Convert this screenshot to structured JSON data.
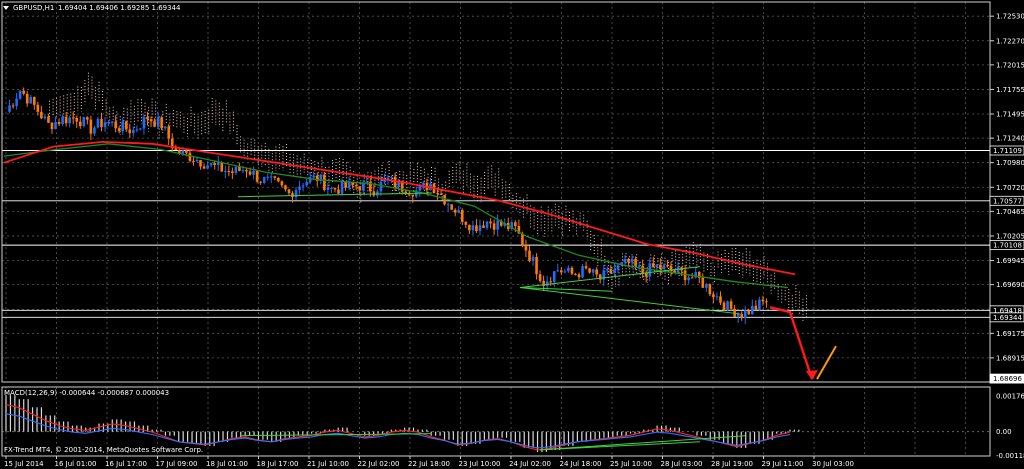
{
  "header": {
    "symbol": "GBPUSD,H1",
    "ohlc": "1.69404 1.69406 1.69285 1.69344"
  },
  "macd_label": "MACD(12,26,9) -0.000644 -0.000687 0.000043",
  "copyright": "FX-Trend MT4, © 2001-2014, MetaQuotes Software Corp.",
  "colors": {
    "background": "#000000",
    "grid": "#5a5a5a",
    "candle_up": "#1e6bff",
    "candle_down": "#ff7a00",
    "ma_red": "#ff1a1a",
    "ma_green": "#1f8a1f",
    "trendline": "#40d040",
    "cloud": "#f0c8c8",
    "arrow_down": "#ff1a1a",
    "arrow_up": "#ff9900",
    "hline": "#ffffff"
  },
  "chart_data": [
    {
      "type": "candlestick",
      "title": "GBPUSD,H1",
      "ylim": [
        1.6866,
        1.7268
      ],
      "y_ticks": [
        "1.72530",
        "1.72270",
        "1.72015",
        "1.71755",
        "1.71495",
        "1.71240",
        "1.70980",
        "1.70720",
        "1.70465",
        "1.70205",
        "1.69945",
        "1.69690",
        "1.69430",
        "1.69175",
        "1.68915"
      ],
      "price_boxes": [
        "1.71109",
        "1.70577",
        "1.70108",
        "1.69418",
        "1.69344",
        "1.68696"
      ],
      "x_ticks": [
        "15 Jul 2014",
        "16 Jul 01:00",
        "16 Jul 17:00",
        "17 Jul 09:00",
        "18 Jul 01:00",
        "18 Jul 17:00",
        "21 Jul 10:00",
        "22 Jul 02:00",
        "22 Jul 18:00",
        "23 Jul 10:00",
        "24 Jul 02:00",
        "24 Jul 18:00",
        "25 Jul 10:00",
        "28 Jul 03:00",
        "28 Jul 19:00",
        "29 Jul 11:00",
        "30 Jul 03:00"
      ],
      "horizontal_levels": [
        1.71109,
        1.70577,
        1.70108,
        1.69418,
        1.69344
      ],
      "close_path": [
        1.7152,
        1.7175,
        1.7158,
        1.7138,
        1.7144,
        1.7146,
        1.7134,
        1.7142,
        1.7136,
        1.7132,
        1.7146,
        1.7138,
        1.711,
        1.7105,
        1.7098,
        1.7092,
        1.7088,
        1.7092,
        1.708,
        1.7076,
        1.7065,
        1.7078,
        1.7082,
        1.707,
        1.7072,
        1.7074,
        1.707,
        1.708,
        1.7072,
        1.7068,
        1.7076,
        1.706,
        1.7044,
        1.703,
        1.7036,
        1.7032,
        1.7028,
        1.7,
        1.6972,
        1.6985,
        1.698,
        1.6984,
        1.6975,
        1.6985,
        1.6992,
        1.6982,
        1.6988,
        1.6984,
        1.698,
        1.6974,
        1.696,
        1.6945,
        1.6938,
        1.6945,
        1.6955
      ],
      "ma_red": [
        1.7098,
        1.7115,
        1.712,
        1.7118,
        1.711,
        1.7102,
        1.7094,
        1.7086,
        1.7078,
        1.7068,
        1.7058,
        1.7044,
        1.7028,
        1.7012,
        1.7002,
        1.699,
        1.698
      ],
      "ma_green": [
        1.7105,
        1.7112,
        1.7118,
        1.7112,
        1.71,
        1.7088,
        1.708,
        1.7076,
        1.7066,
        1.7052,
        1.702,
        1.7,
        1.6988,
        1.698,
        1.6972,
        1.6966
      ],
      "forecast": {
        "from": 1.6945,
        "low": 1.6869,
        "up_to": 1.6904
      }
    },
    {
      "type": "bar",
      "title": "MACD(12,26,9) -0.000644 -0.000687 0.000043",
      "ylim": [
        -0.0012,
        0.0022
      ],
      "y_ticks": [
        "0.001766",
        "0.00",
        "-0.001180"
      ],
      "values": [
        0.0018,
        0.0016,
        0.0012,
        0.0008,
        0.0005,
        0.0003,
        0.0002,
        0.0004,
        0.0006,
        0.0005,
        0.0003,
        0.0001,
        -0.0002,
        -0.0005,
        -0.0006,
        -0.0007,
        -0.0005,
        -0.0003,
        -0.0002,
        -0.0004,
        -0.0005,
        -0.0003,
        -0.0002,
        -0.0001,
        0.0001,
        0.0002,
        0.0,
        -0.0002,
        -0.0001,
        0.0001,
        0.0002,
        0.0001,
        -0.0002,
        -0.0004,
        -0.0007,
        -0.0006,
        -0.0004,
        -0.0003,
        -0.0005,
        -0.0008,
        -0.001,
        -0.0009,
        -0.0007,
        -0.0005,
        -0.0004,
        -0.0003,
        -0.0002,
        -0.0001,
        0.0001,
        0.0003,
        0.0002,
        0.0,
        -0.0002,
        -0.0004,
        -0.0006,
        -0.0008,
        -0.0006,
        -0.0004,
        -0.0001,
        0.0001
      ]
    }
  ]
}
